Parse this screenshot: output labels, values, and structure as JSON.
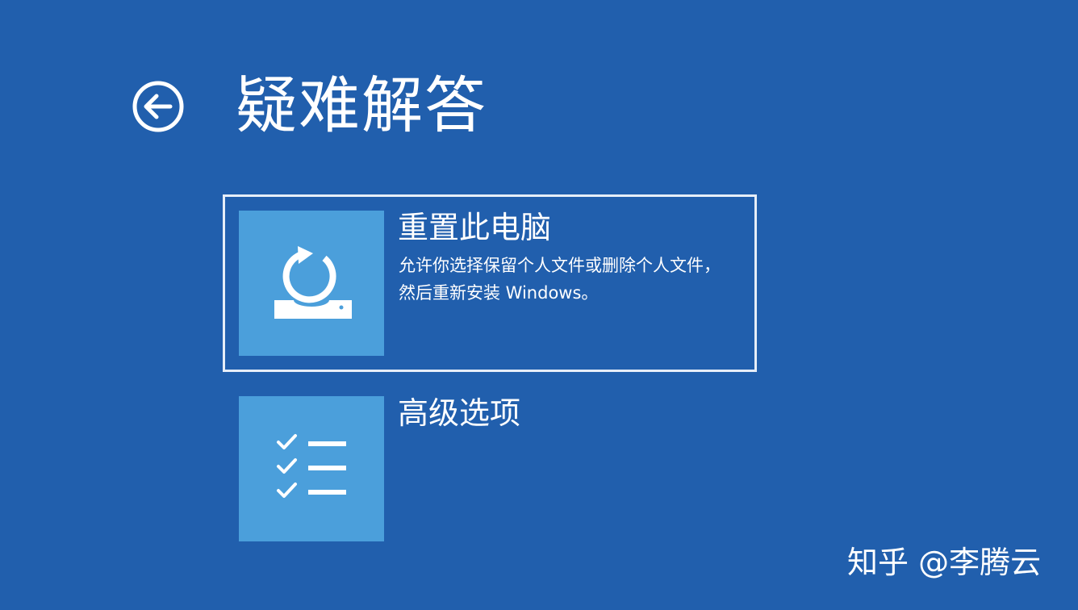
{
  "header": {
    "title": "疑难解答",
    "back_icon": "back-arrow-icon"
  },
  "options": [
    {
      "title": "重置此电脑",
      "description": "允许你选择保留个人文件或删除个人文件，然后重新安装 Windows。",
      "icon": "reset-pc-icon",
      "selected": true
    },
    {
      "title": "高级选项",
      "description": "",
      "icon": "checklist-icon",
      "selected": false
    }
  ],
  "watermark": "知乎 @李腾云",
  "colors": {
    "background": "#215fad",
    "tile": "#4b9fdb",
    "text": "#ffffff",
    "selection_border": "#e6eef8"
  }
}
